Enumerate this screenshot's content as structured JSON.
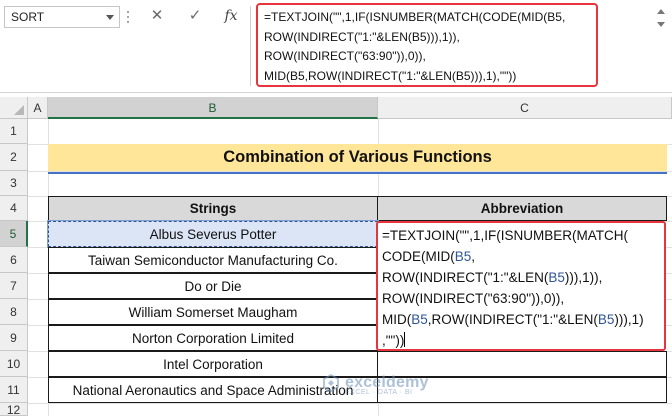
{
  "formula_bar": {
    "name_box": "SORT",
    "cancel_icon": "✕",
    "enter_icon": "✓",
    "fx_label": "fx",
    "formula_lines": [
      "=TEXTJOIN(\"\",1,IF(ISNUMBER(MATCH(CODE(MID(B5,",
      "ROW(INDIRECT(\"1:\"&LEN(B5))),1)),",
      "ROW(INDIRECT(\"63:90\")),0)),",
      "MID(B5,ROW(INDIRECT(\"1:\"&LEN(B5))),1),\"\"))"
    ],
    "highlight_color": "#e8343c"
  },
  "columns": [
    "A",
    "B",
    "C"
  ],
  "rows": [
    "1",
    "2",
    "3",
    "4",
    "5",
    "6",
    "7",
    "8",
    "9",
    "10",
    "11",
    "12"
  ],
  "sheet": {
    "title": "Combination of Various Functions",
    "title_fill": "#ffe699",
    "header_strings": "Strings",
    "header_abbreviation": "Abbreviation",
    "strings": [
      "Albus Severus Potter",
      "Taiwan Semiconductor Manufacturing Co.",
      "Do or Die",
      "William Somerset Maugham",
      "Norton Corporation Limited",
      "Intel Corporation",
      "National Aeronautics and Space Administration"
    ]
  },
  "active_cell": "B5",
  "watermark": {
    "name": "exceldemy",
    "tagline": "EXCEL · DATA · BI"
  }
}
